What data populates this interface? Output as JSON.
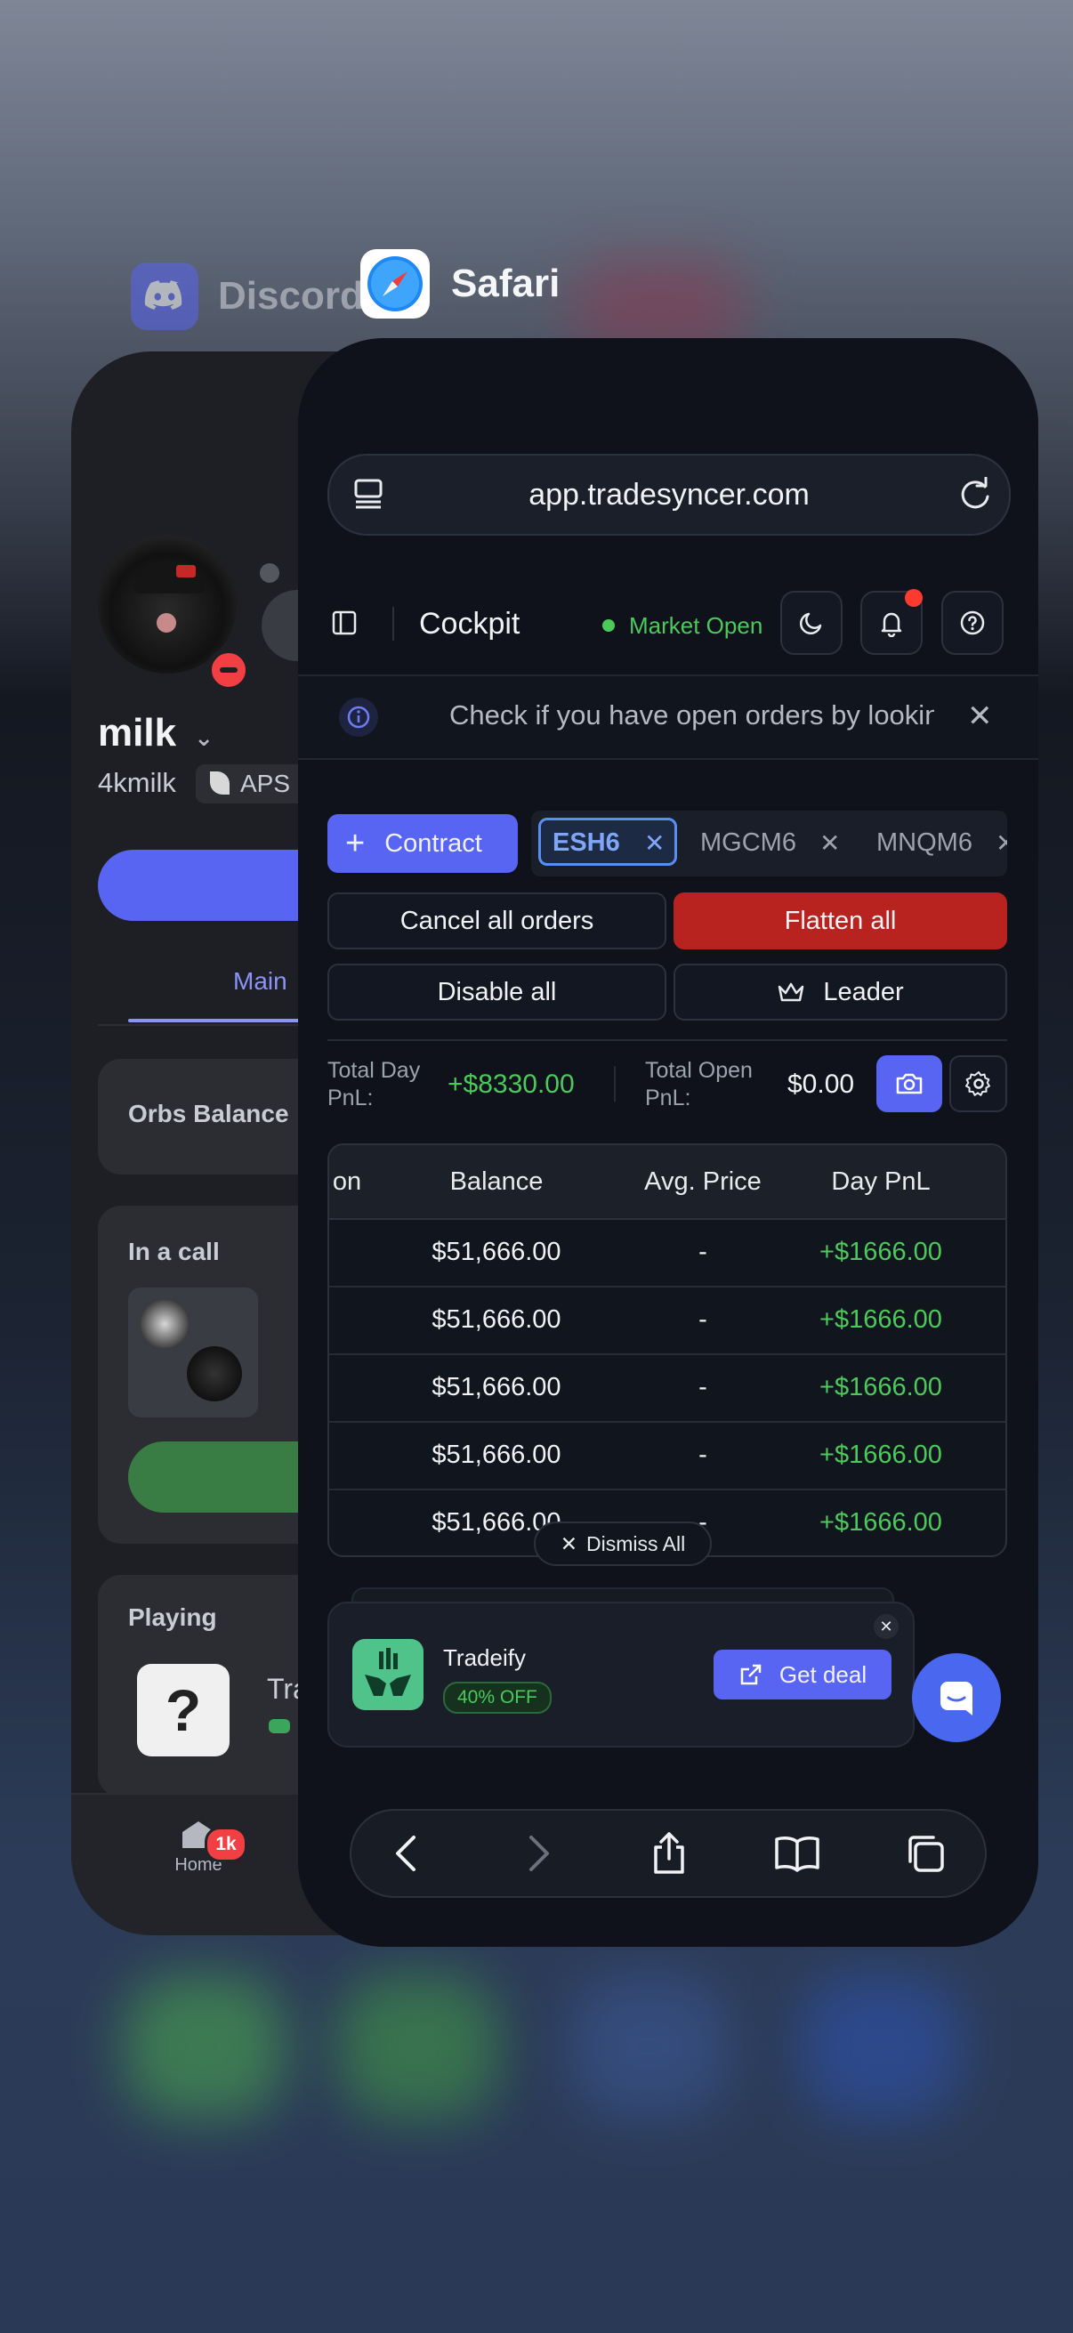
{
  "discord": {
    "app_name": "Discord",
    "username": "milk",
    "handle": "4kmilk",
    "tag": "APS",
    "tab_main": "Main",
    "orbs_label": "Orbs Balance",
    "in_call_label": "In a call",
    "playing_label": "Playing",
    "game_partial": "Tra",
    "nav_home": "Home",
    "home_badge": "1k"
  },
  "safari": {
    "app_name": "Safari",
    "url": "app.tradesyncer.com",
    "page_title": "Cockpit",
    "market_status": "Market Open",
    "banner_text": "Check if you have open orders by looking",
    "contract_button": "Contract",
    "contract_chips": [
      "ESH6",
      "MGCM6",
      "MNQM6"
    ],
    "cancel_all": "Cancel all orders",
    "flatten_all": "Flatten all",
    "disable_all": "Disable all",
    "leader": "Leader",
    "total_day_pnl_label": "Total Day PnL:",
    "total_day_pnl_value": "+$8330.00",
    "total_open_pnl_label": "Total Open PnL:",
    "total_open_pnl_value": "$0.00",
    "table": {
      "columns": [
        "on",
        "Balance",
        "Avg. Price",
        "Day PnL"
      ],
      "rows": [
        [
          "$51,666.00",
          "-",
          "+$1666.00"
        ],
        [
          "$51,666.00",
          "-",
          "+$1666.00"
        ],
        [
          "$51,666.00",
          "-",
          "+$1666.00"
        ],
        [
          "$51,666.00",
          "-",
          "+$1666.00"
        ],
        [
          "$51,666.00",
          "-",
          "+$1666.00"
        ]
      ]
    },
    "dismiss_all": "Dismiss All",
    "promo": {
      "name": "Tradeify",
      "discount": "40% OFF",
      "cta": "Get deal"
    }
  },
  "colors": {
    "accent": "#5865f2",
    "danger": "#b8231f",
    "positive": "#4cc95b",
    "notification": "#ff3b30"
  }
}
